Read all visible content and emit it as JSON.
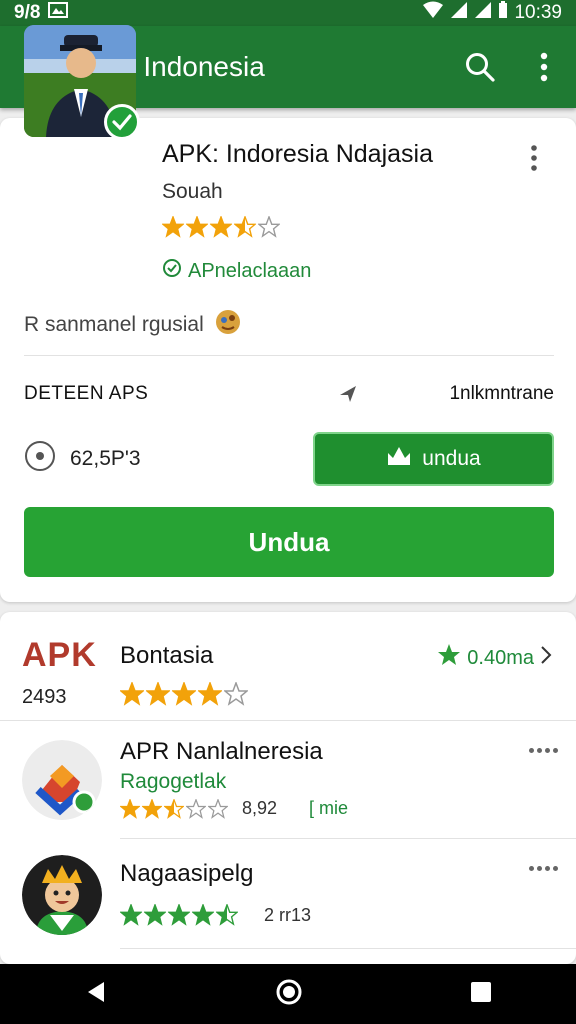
{
  "status_bar": {
    "left_text": "9/8",
    "right_time": "10:39"
  },
  "app_bar": {
    "title": "APR Indonesia"
  },
  "featured": {
    "title": "APK: Indoresia Ndajasia",
    "subtitle": "Souah",
    "rating": 3.5,
    "verified_label": "APnelaclaaan",
    "description": "R sanmanel rgusial",
    "info_label": "DETEEN APS",
    "info_value": "1nlkmntrane",
    "size": "62,5P'3",
    "install_small_label": "undua",
    "install_big_label": "Undua"
  },
  "list": {
    "header": {
      "logo": "APK",
      "title": "Bontasia",
      "rating_text": "0.40ma",
      "count": "2493",
      "rating": 4
    },
    "items": [
      {
        "title": "APR Nanlalneresia",
        "subtitle": "Ragogetlak",
        "rating": 2.5,
        "meta": "8,92",
        "tag": "[ mie"
      },
      {
        "title": "Nagaasipelg",
        "rating": 4.5,
        "meta": "2 rr13"
      }
    ]
  },
  "colors": {
    "primary": "#1f7a33",
    "accent": "#27a334",
    "star": "#f2a20a"
  }
}
